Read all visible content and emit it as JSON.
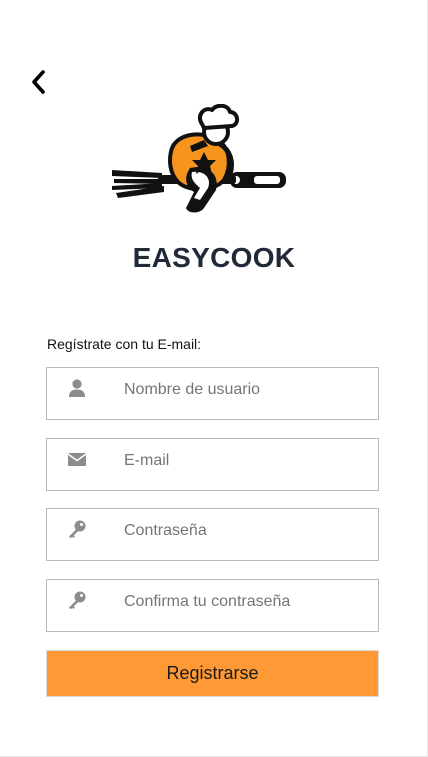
{
  "header": {
    "back_icon": "chevron-left-icon"
  },
  "brand": {
    "logo_icon": "chef-riding-fork-logo",
    "title": "EASYCOOK",
    "accent_color": "#ff9935"
  },
  "form": {
    "label": "Regístrate con tu E-mail:",
    "fields": [
      {
        "icon": "user-icon",
        "placeholder": "Nombre de usuario",
        "value": ""
      },
      {
        "icon": "envelope-icon",
        "placeholder": "E-mail",
        "value": ""
      },
      {
        "icon": "key-icon",
        "placeholder": "Contraseña",
        "value": ""
      },
      {
        "icon": "key-icon",
        "placeholder": "Confirma tu contraseña",
        "value": ""
      }
    ],
    "submit_label": "Registrarse"
  }
}
